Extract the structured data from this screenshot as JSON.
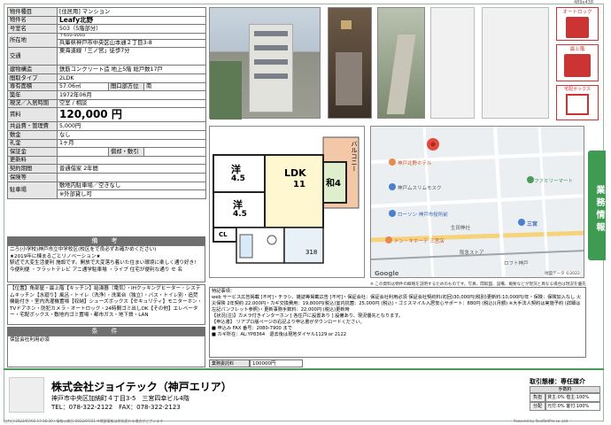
{
  "page_code": "489x438",
  "spec": {
    "type_label": "物件種目",
    "type_value": "[住居用] マンション",
    "name_label": "物件名",
    "name_value": "Leafy北野",
    "room_label": "号室名",
    "room_value": "503（5階部分）",
    "addr_label": "所在地",
    "addr_zip": "〒650-0003",
    "addr_value": "兵庫県神戸市中央区山本通２丁目3-8",
    "transit_label": "交通",
    "transit_value": "東海道線「三ノ宮」徒歩7分",
    "structure_label": "建物構造",
    "structure_value": "鉄筋コンクリート造 地上5階 総戸数17戸",
    "layout_label": "間取タイプ",
    "layout_value": "2LDK",
    "area_label": "専有面積",
    "area_value": "57.06㎡",
    "bay_label": "間口部方位",
    "bay_value": "南",
    "built_label": "築年",
    "built_value": "1972年06月",
    "status_label": "現況／入居時期",
    "status_value": "空室 / 相談",
    "rent_label": "賃料",
    "rent_value": "120,000 円",
    "common_label": "共益費・管理費",
    "common_value": "5,000円",
    "deposit_label": "敷金",
    "deposit_value": "なし",
    "key_label": "礼金",
    "key_value": "1ヶ月",
    "bond_label": "保証金",
    "bond_sub": "償却・敷引",
    "renew_label": "更新料",
    "contract_label": "契約期間",
    "contract_value": "普通借家 2年間",
    "insurance_label": "保険等",
    "parking_label": "駐車場",
    "parking_value": "敷地内駐車場／空きなし",
    "parking_note": "※外部貸し可",
    "remarks_header": "備　考",
    "remarks_text": "二ろ(小学校)神戸市立中学校区(校区をで良必ずお確かめください)\n★2019年に棟まるごとリノベーション★\n駅近で大変生活便利 施設です。開放で大変落ち着いた住まい環境に楽しく通り好き!\n今便利便 ・フラットテレビ アニ通学駐車場 ・ライブ 住宅が便利な通り セ 名",
    "facilities_text": "【位置】角部屋・最上階【キッチン】給湯器（電気）・IHクッキングヒーター・システムキッチン【水廻り】風呂・トイレ（洗浄）・洗面台（独立）・バス・トイレ別・追焚機能付き・室内洗濯機置場【収納】シューズボックス【セキュリティ】モニターホン・TVドアホン・防犯カメラ・オートロック・24時間ゴミ出しOK【その他】エレベーター・宅配ボックス・敷地内ゴミ置場・都市ガス・地下鉄・LAN",
    "cond_header": "条　件",
    "cond_text": "保証会社利用必須"
  },
  "tags": {
    "autolock": "オートロック",
    "top_floor": "最上階",
    "delivery_box": "宅配ボックス"
  },
  "floorplan": {
    "room1": "洋",
    "room1_size": "4.5",
    "room2": "洋",
    "room2_size": "4.5",
    "ldk": "LDK",
    "ldk_size": "11",
    "washitsu": "和4",
    "balcony": "バルコニー",
    "cl": "CL",
    "s": "S",
    "sd": "S",
    "vc": "318"
  },
  "map": {
    "labels": [
      "神戸北野ホテル",
      "神戸ムスリムモスク",
      "ローソン 神戸市役所前",
      "ドン・キホーテ 三宮店",
      "ファミリーマート",
      "生田神社",
      "三宮",
      "ロフト神戸",
      "阪急ストア"
    ],
    "google": "Google",
    "copyright": "地図データ ©2022"
  },
  "note": "※ この資料は物件の概略を説明するためのものです。写真、間取図、設備、概要などが現況と異なる場合は現況を優先とします。",
  "side_label": "業務情報",
  "notes": {
    "title": "特記事項：",
    "body": "web サービス広告掲載 [不可]・チラシ、雑誌等掲載広告 [不可]・保証会社：保証会社利用必須 保証会社契約料(初回)30,000円(税別)更新料:10,000円/年・保険：保険加入なし 火災保険 2年契約 22,000円・カギ交換費用：19,800円(税込)室内抗菌：25,000円 (税込)・ゴミスマイル入居安心サポート：880円 (税込)(月額) ※大手法人契約は実施予約 (詳細は左記パンフレット参照)・更新事務手数料：22,000円 (税込)更新時",
    "body2": "【状況(注)】カメラ付きインターホン [ 各住戸に設置あり ] 設備あり、現況優先となります。",
    "body3": "【申込書】 リアプロ版ページの右記より申込書がダウンロードください。",
    "body4": "■ 申込み FAX 番号：2080-7900 まで",
    "key_info": "■ カギ所在：AL:YP8364　退去後は現地ダイヤル1129 or 2122"
  },
  "fee": {
    "label": "業務委託料",
    "value": "100000円"
  },
  "company": {
    "name": "株式会社ジョイテック（神戸エリア）",
    "address": "神戸市中央区加納町４丁目3-5　三宮四幸ビル4階",
    "tel": "TEL：078-322-2122　FAX：078-322-2123"
  },
  "deal": {
    "title": "取引態様：専任媒介",
    "fee_head": "手数料",
    "row1_label": "負担",
    "row1_value": "貸主:0%  借主:100%",
    "row2_label": "分配",
    "row2_value": "元付:0%  客付:100%"
  },
  "footer": {
    "left": "出力日:2022/07/02 17:16:30 / 情報公開日:2022/07/21 ※掲載情報は原則変わる場合がございます",
    "right": "Powered by RealNetPro co.,Ltd"
  }
}
